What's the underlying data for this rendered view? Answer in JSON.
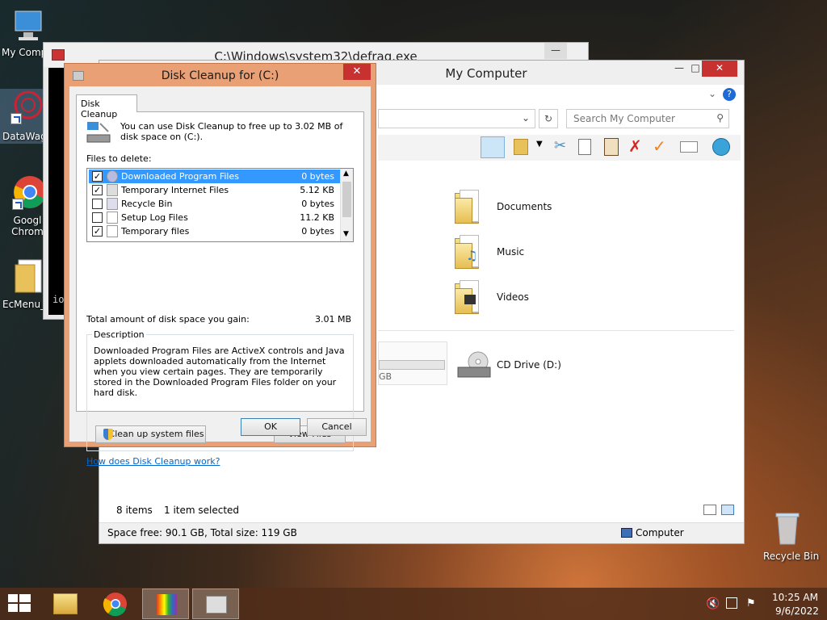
{
  "desktop": {
    "icons": [
      {
        "label": "My Comp"
      },
      {
        "label": "DataWag"
      },
      {
        "label": "Googl Chrom"
      },
      {
        "label": "EcMenu_"
      },
      {
        "label": "Recycle Bin"
      }
    ]
  },
  "defrag": {
    "title": "C:\\Windows\\system32\\defrag.exe",
    "console_fragment": "io"
  },
  "mycomputer": {
    "title": "My Computer",
    "search_placeholder": "Search My Computer",
    "items": [
      {
        "label": "Documents"
      },
      {
        "label": "Music"
      },
      {
        "label": "Videos"
      },
      {
        "label": "CD Drive (D:)"
      }
    ],
    "drive_fragment": "GB",
    "status": {
      "items_count": "8 items",
      "selected": "1 item selected",
      "space": "Space free: 90.1 GB, Total size: 119 GB",
      "location": "Computer"
    }
  },
  "dialog": {
    "title": "Disk Cleanup for  (C:)",
    "tab": "Disk Cleanup",
    "intro": "You can use Disk Cleanup to free up to 3.02 MB of disk space on  (C:).",
    "files_label": "Files to delete:",
    "files": [
      {
        "name": "Downloaded Program Files",
        "size": "0 bytes",
        "checked": true
      },
      {
        "name": "Temporary Internet Files",
        "size": "5.12 KB",
        "checked": true
      },
      {
        "name": "Recycle Bin",
        "size": "0 bytes",
        "checked": false
      },
      {
        "name": "Setup Log Files",
        "size": "11.2 KB",
        "checked": false
      },
      {
        "name": "Temporary files",
        "size": "0 bytes",
        "checked": true
      }
    ],
    "total_label": "Total amount of disk space you gain:",
    "total_value": "3.01 MB",
    "description_label": "Description",
    "description_text": "Downloaded Program Files are ActiveX controls and Java applets downloaded automatically from the Internet when you view certain pages. They are temporarily stored in the Downloaded Program Files folder on your hard disk.",
    "cleanup_system_label": "Clean up system files",
    "view_files_label": "View Files",
    "help_link": "How does Disk Cleanup work?",
    "ok_label": "OK",
    "cancel_label": "Cancel"
  },
  "taskbar": {
    "time": "10:25 AM",
    "date": "9/6/2022"
  }
}
